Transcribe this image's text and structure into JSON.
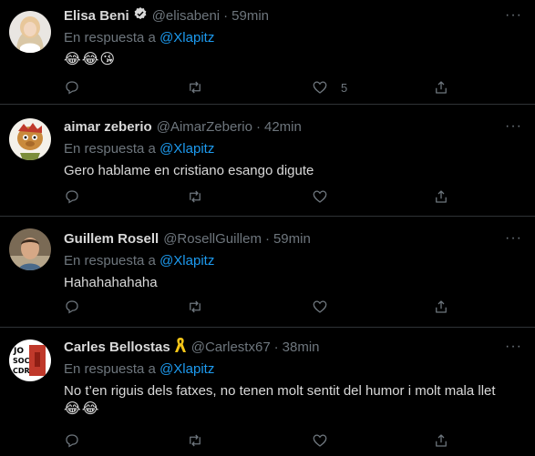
{
  "tweets": [
    {
      "name": "Elisa Beni",
      "handle": "@elisabeni",
      "time": "59min",
      "reply_prefix": "En respuesta a",
      "reply_to": "@Xlapitz",
      "text": "😂😂😘",
      "like_count": "5",
      "verified": true
    },
    {
      "name": "aimar zeberio",
      "handle": "@AimarZeberio",
      "time": "42min",
      "reply_prefix": "En respuesta a",
      "reply_to": "@Xlapitz",
      "text": "Gero hablame en cristiano esango digute",
      "like_count": ""
    },
    {
      "name": "Guillem Rosell",
      "handle": "@RosellGuillem",
      "time": "59min",
      "reply_prefix": "En respuesta a",
      "reply_to": "@Xlapitz",
      "text": "Hahahahahaha",
      "like_count": ""
    },
    {
      "name": "Carles Bellostas",
      "handle": "@Carlestx67",
      "time": "38min",
      "reply_prefix": "En respuesta a",
      "reply_to": "@Xlapitz",
      "text": "No t’en riguis dels fatxes, no tenen molt sentit del humor i molt mala llet",
      "text2": "😂😂",
      "like_count": "",
      "avatar_text": "JO SOC CDR"
    }
  ],
  "separator": "·",
  "colors": {
    "background": "#000000",
    "text": "#d9d9d9",
    "muted": "#6e767d",
    "accent": "#1d9bf0",
    "ribbon": "#f5c518"
  }
}
